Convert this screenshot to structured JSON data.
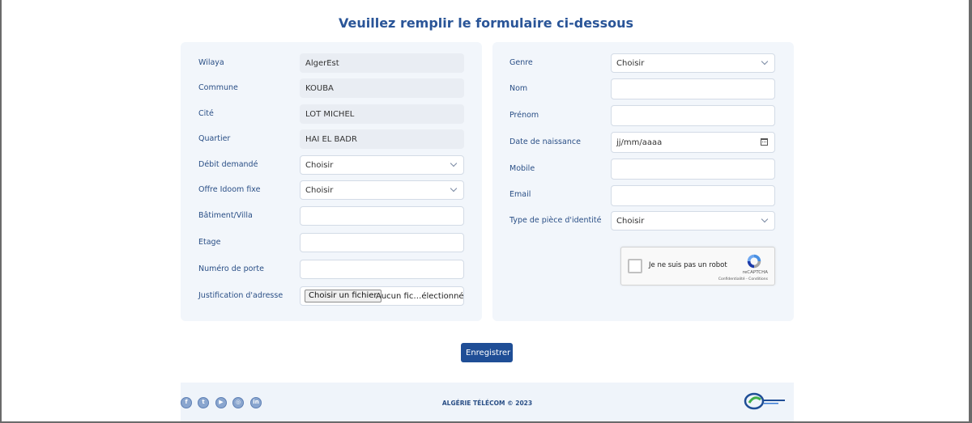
{
  "page": {
    "title": "Veuillez remplir le formulaire ci-dessous"
  },
  "left_form": {
    "fields": [
      {
        "label": "Wilaya",
        "value": "AlgerEst"
      },
      {
        "label": "Commune",
        "value": "KOUBA"
      },
      {
        "label": "Cité",
        "value": "LOT MICHEL"
      },
      {
        "label": "Quartier",
        "value": "HAI EL BADR"
      },
      {
        "label": "Débit demandé",
        "value": "Choisir"
      },
      {
        "label": "Offre Idoom fixe",
        "value": "Choisir"
      },
      {
        "label": "Bâtiment/Villa",
        "value": ""
      },
      {
        "label": "Etage",
        "value": ""
      },
      {
        "label": "Numéro de porte",
        "value": ""
      },
      {
        "label": "Justification d'adresse",
        "button": "Choisir un fichier",
        "value": "Aucun fic…électionné"
      }
    ]
  },
  "right_form": {
    "fields": [
      {
        "label": "Genre",
        "value": "Choisir"
      },
      {
        "label": "Nom",
        "value": ""
      },
      {
        "label": "Prénom",
        "value": ""
      },
      {
        "label": "Date de naissance",
        "value": "jj/mm/aaaa"
      },
      {
        "label": "Mobile",
        "value": ""
      },
      {
        "label": "Email",
        "value": ""
      },
      {
        "label": "Type de pièce d'identité",
        "value": "Choisir"
      }
    ]
  },
  "captcha": {
    "label": "Je ne suis pas un robot",
    "brand": "reCAPTCHA",
    "links": "Confidentialité - Conditions"
  },
  "actions": {
    "save_label": "Enregistrer"
  },
  "footer": {
    "copyright": "ALGÉRIE TÉLÉCOM © 2023",
    "social": [
      {
        "icon": "facebook-icon",
        "glyph": "f"
      },
      {
        "icon": "twitter-icon",
        "glyph": "t"
      },
      {
        "icon": "youtube-icon",
        "glyph": "▶"
      },
      {
        "icon": "instagram-icon",
        "glyph": "◎"
      },
      {
        "icon": "linkedin-icon",
        "glyph": "in"
      }
    ]
  },
  "colors": {
    "primary": "#1f4e96",
    "card_bg": "#f2f6fb",
    "label": "#2a4f86"
  }
}
